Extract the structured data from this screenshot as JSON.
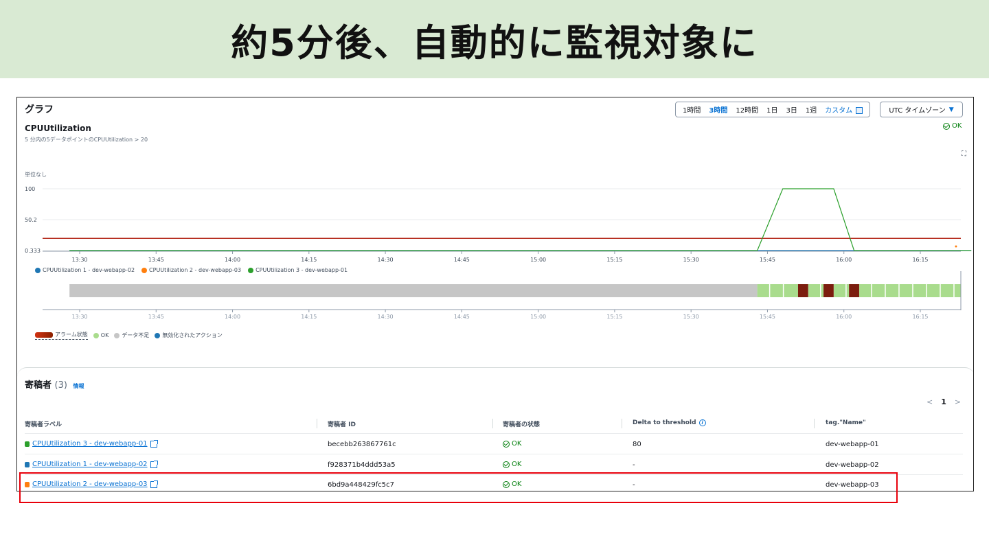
{
  "banner": {
    "title": "約5分後、自動的に監視対象に"
  },
  "graph": {
    "title": "グラフ",
    "ranges": [
      "1時間",
      "3時間",
      "12時間",
      "1日",
      "3日",
      "1週"
    ],
    "active_range": "3時間",
    "custom_label": "カスタム",
    "timezone_label": "UTC タイムゾーン"
  },
  "chart_panel": {
    "title": "CPUUtilization",
    "subtitle": "5 分内の5データポイントのCPUUtilization > 20",
    "status": "OK",
    "unit_label": "単位なし"
  },
  "chart_data": {
    "type": "line",
    "title": "CPUUtilization",
    "ylabel": "単位なし",
    "y_ticks": [
      "100",
      "50.2",
      "0.333"
    ],
    "ylim": [
      0.333,
      100
    ],
    "x_ticks": [
      "13:30",
      "13:45",
      "14:00",
      "14:15",
      "14:30",
      "14:45",
      "15:00",
      "15:15",
      "15:30",
      "15:45",
      "16:00",
      "16:15"
    ],
    "threshold": 20,
    "series": [
      {
        "name": "CPUUtilization 1 - dev-webapp-02",
        "color": "#1f77b4",
        "points": [
          [
            "13:28",
            0.333
          ],
          [
            "16:25",
            0.333
          ]
        ]
      },
      {
        "name": "CPUUtilization 2 - dev-webapp-03",
        "color": "#ff7f0e",
        "points": [
          [
            "16:22",
            7
          ]
        ]
      },
      {
        "name": "CPUUtilization 3 - dev-webapp-01",
        "color": "#2ca02c",
        "points": [
          [
            "13:28",
            0.333
          ],
          [
            "15:43",
            0.333
          ],
          [
            "15:48",
            100
          ],
          [
            "15:58",
            100
          ],
          [
            "16:02",
            0.333
          ],
          [
            "16:25",
            0.333
          ]
        ]
      }
    ],
    "threshold_color": "#b52c1e",
    "grid": true,
    "legend": "bottom-left"
  },
  "alarm_timeline": {
    "x_ticks": [
      "13:30",
      "13:45",
      "14:00",
      "14:15",
      "14:30",
      "14:45",
      "15:00",
      "15:15",
      "15:30",
      "15:45",
      "16:00",
      "16:15"
    ],
    "states": [
      {
        "state": "insufficient",
        "from": "13:28",
        "to": "15:43"
      },
      {
        "state": "ok",
        "from": "15:43",
        "to": "15:51"
      },
      {
        "state": "alarm",
        "from": "15:51",
        "to": "15:53"
      },
      {
        "state": "ok",
        "from": "15:53",
        "to": "15:56"
      },
      {
        "state": "alarm",
        "from": "15:56",
        "to": "15:58"
      },
      {
        "state": "ok",
        "from": "15:58",
        "to": "16:01"
      },
      {
        "state": "alarm",
        "from": "16:01",
        "to": "16:03"
      },
      {
        "state": "ok",
        "from": "16:03",
        "to": "16:25"
      }
    ],
    "colors": {
      "insufficient": "#c6c6c6",
      "ok": "#a9dc8d",
      "alarm": "#7b1d0e"
    }
  },
  "legend": {
    "series": [
      "CPUUtilization 1 - dev-webapp-02",
      "CPUUtilization 2 - dev-webapp-03",
      "CPUUtilization 3 - dev-webapp-01"
    ],
    "alarm_state": "アラーム状態",
    "ok": "OK",
    "insufficient": "データ不足",
    "disabled_action": "無効化されたアクション"
  },
  "contributors": {
    "title": "寄稿者",
    "count": "(3)",
    "info_label": "情報",
    "page": "1",
    "columns": [
      "寄稿者ラベル",
      "寄稿者 ID",
      "寄稿者の状態",
      "Delta to threshold",
      "tag.\"Name\""
    ],
    "rows": [
      {
        "label": "CPUUtilization 3 - dev-webapp-01",
        "color": "#2ca02c",
        "id": "becebb263867761c",
        "state": "OK",
        "delta": "80",
        "tag": "dev-webapp-01"
      },
      {
        "label": "CPUUtilization 1 - dev-webapp-02",
        "color": "#1f77b4",
        "id": "f928371b4ddd53a5",
        "state": "OK",
        "delta": "-",
        "tag": "dev-webapp-02"
      },
      {
        "label": "CPUUtilization 2 - dev-webapp-03",
        "color": "#ff7f0e",
        "id": "6bd9a448429fc5c7",
        "state": "OK",
        "delta": "-",
        "tag": "dev-webapp-03"
      }
    ]
  },
  "colors": {
    "highlight": "#e8000b",
    "accent": "#0972d3",
    "ok": "#037f0c",
    "banner_bg": "#d9ead3"
  }
}
